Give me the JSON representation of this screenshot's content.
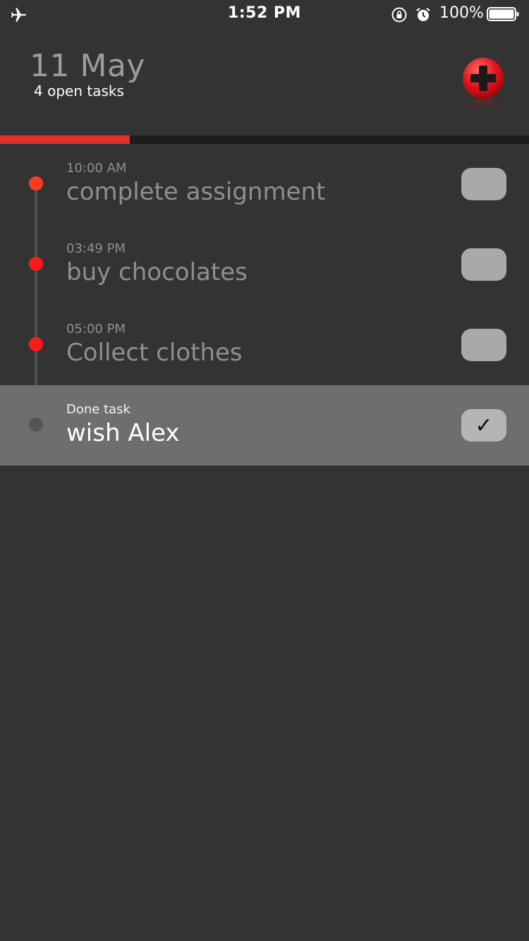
{
  "status_bar": {
    "time": "1:52 PM",
    "battery_percent": "100%",
    "icons": [
      "airplane-icon",
      "rotation-lock-icon",
      "alarm-icon",
      "battery-icon"
    ]
  },
  "header": {
    "date": "11 May",
    "subtitle": "4 open tasks",
    "add_button_icon": "plus-icon"
  },
  "progress": {
    "fraction": 0.245,
    "fill_color": "#e0302a"
  },
  "tasks": [
    {
      "meta": "10:00 AM",
      "title": "complete assignment",
      "done": false,
      "dot_color": "#ff3b1f"
    },
    {
      "meta": "03:49 PM",
      "title": "buy chocolates",
      "done": false,
      "dot_color": "#ff1a1a"
    },
    {
      "meta": "05:00 PM",
      "title": "Collect clothes",
      "done": false,
      "dot_color": "#ff1a1a"
    },
    {
      "meta": "Done task",
      "title": "wish Alex",
      "done": true,
      "dot_color": "#555555",
      "check_icon": "check-icon",
      "check_mark": "✓"
    }
  ]
}
